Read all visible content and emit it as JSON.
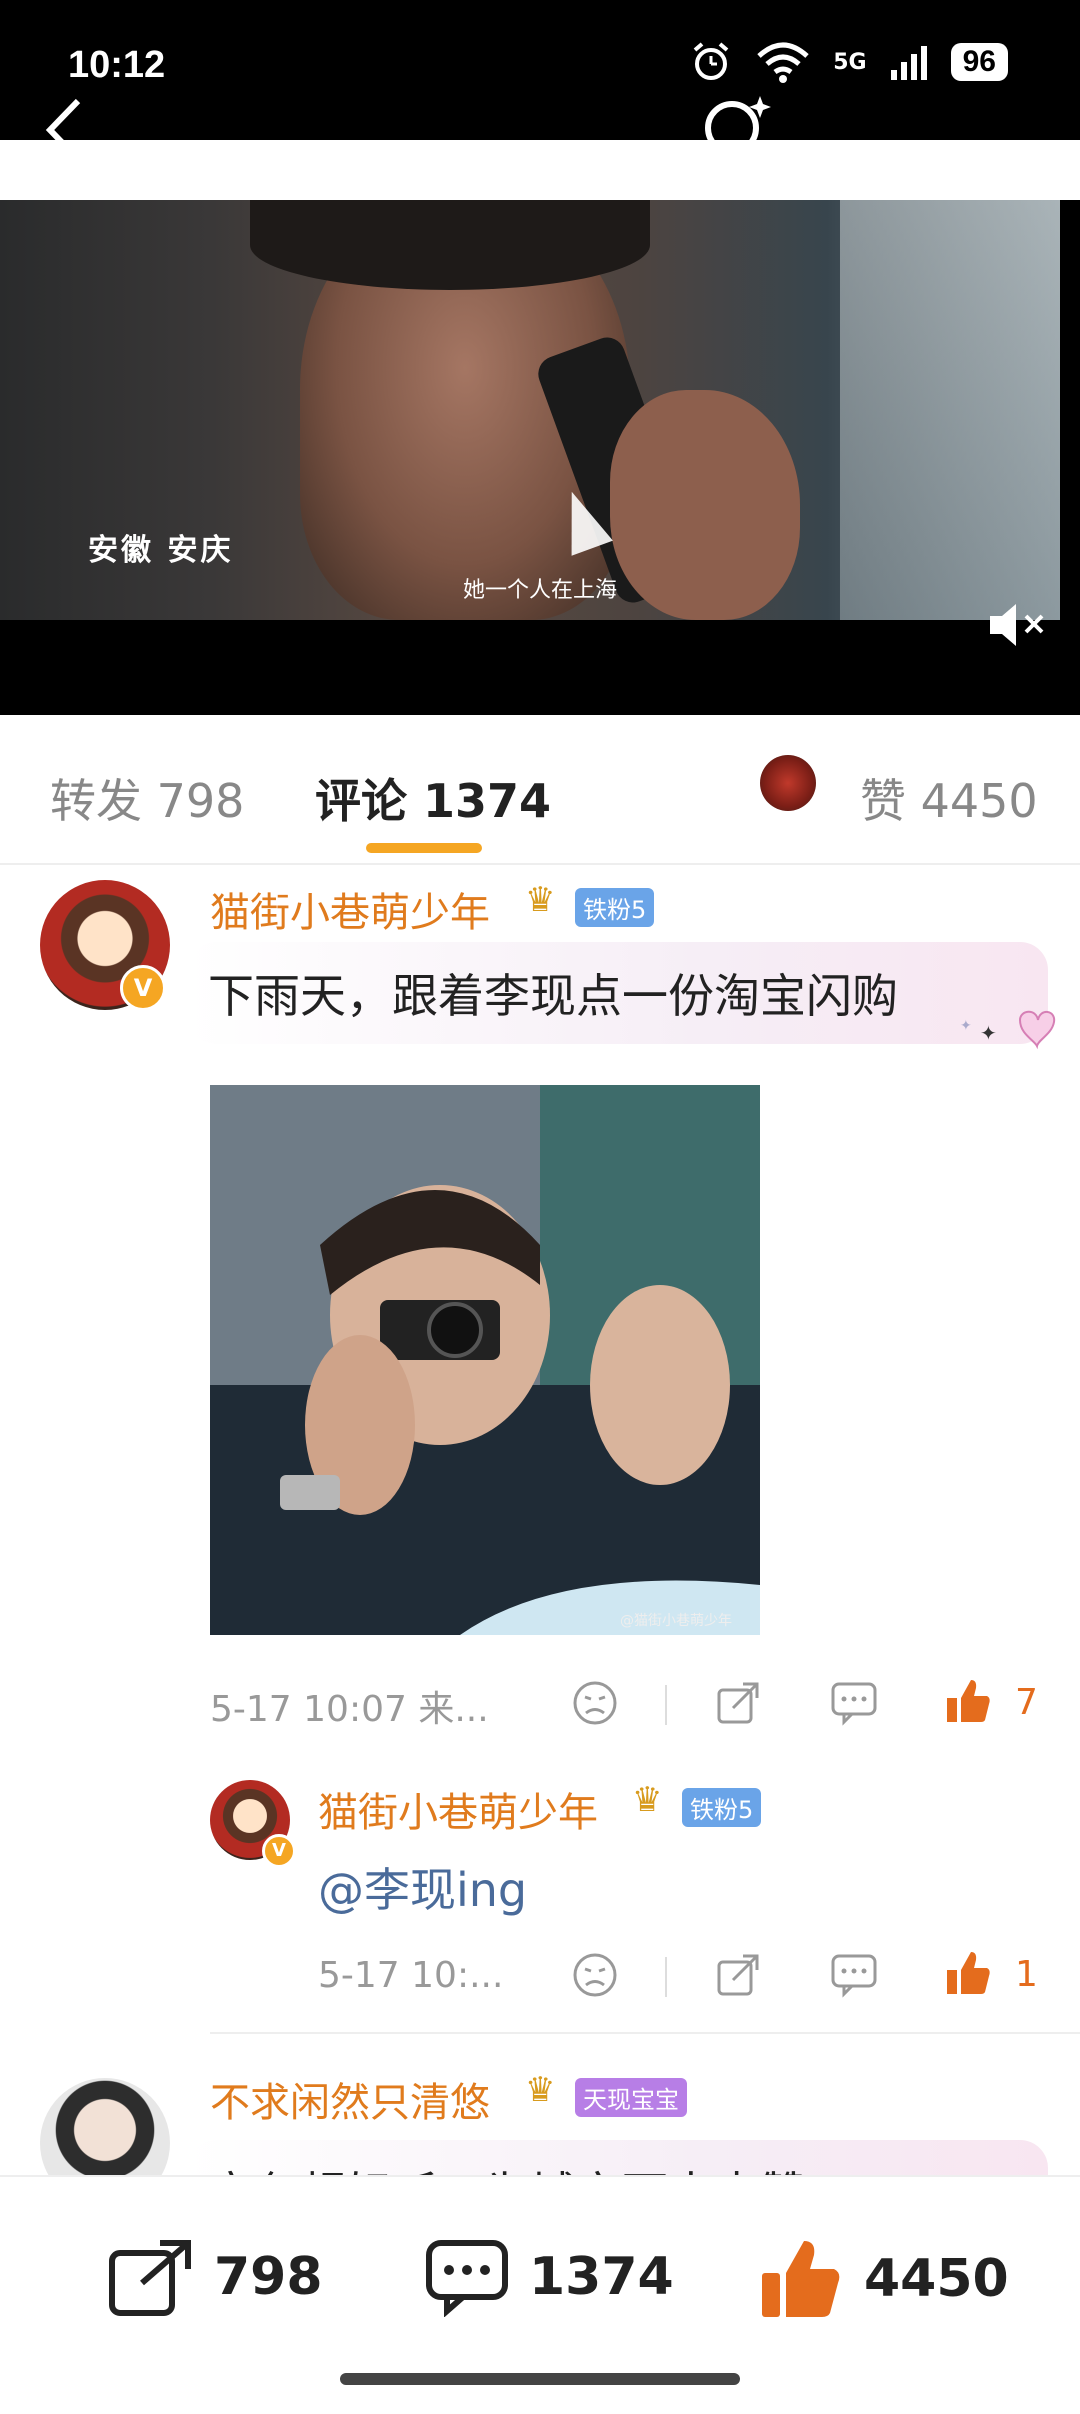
{
  "status": {
    "time": "10:12",
    "battery": "96",
    "signal": "5G"
  },
  "video": {
    "location": "安徽 安庆",
    "subtitle": "她一个人在上海"
  },
  "tabs": {
    "repost": "转发 798",
    "comment": "评论 1374",
    "like": "赞 4450"
  },
  "comment1": {
    "username": "猫街小巷萌少年",
    "fan_badge": "铁粉5",
    "text": "下雨天，跟着李现点一份淘宝闪购",
    "time": "5-17 10:07 来...",
    "likes": "7",
    "image_watermark": "@猫街小巷萌少年"
  },
  "reply1": {
    "username": "猫街小巷萌少年",
    "fan_badge": "铁粉5",
    "text": "@李现ing",
    "time": "5-17 10:...",
    "likes": "1"
  },
  "comment2": {
    "username": "不求闲然只清悠",
    "fan_badge": "天现宝宝",
    "text": "音色超好听，为城市雨中点赞"
  },
  "bottom": {
    "repost": "798",
    "comment": "1374",
    "like": "4450"
  },
  "colors": {
    "accent": "#f5a623",
    "username": "#e07b1d",
    "like": "#e46c1d"
  },
  "icons": [
    "back-icon",
    "search-icon",
    "more-icon",
    "close-icon",
    "mute-icon",
    "sad-face-icon",
    "share-icon",
    "comment-icon",
    "thumb-up-icon",
    "crown-icon"
  ]
}
